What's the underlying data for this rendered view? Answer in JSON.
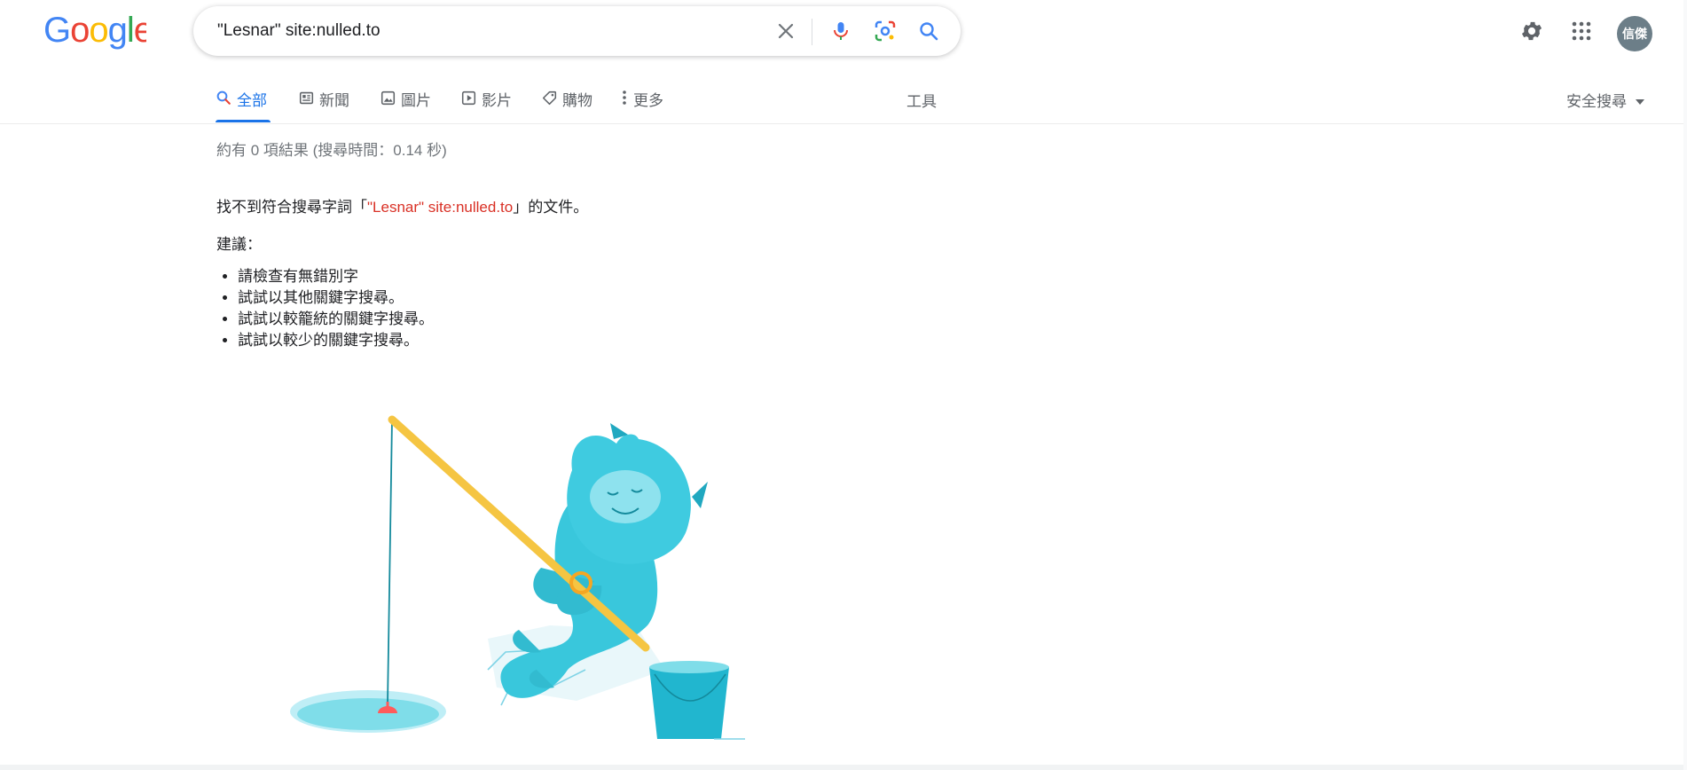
{
  "header": {
    "logo_text": "Google",
    "search": {
      "query": "\"Lesnar\" site:nulled.to"
    },
    "icons": {
      "clear": "close-icon",
      "voice": "microphone-icon",
      "lens": "camera-lens-icon",
      "search": "search-icon",
      "settings": "gear-icon",
      "apps": "apps-grid-icon"
    },
    "avatar_text": "信傑"
  },
  "tabs": [
    {
      "label": "全部",
      "icon": "search-icon",
      "active": true
    },
    {
      "label": "新聞",
      "icon": "news-icon"
    },
    {
      "label": "圖片",
      "icon": "image-icon"
    },
    {
      "label": "影片",
      "icon": "video-icon"
    },
    {
      "label": "購物",
      "icon": "tag-icon"
    },
    {
      "label": "更多",
      "icon": "more-vert-icon"
    }
  ],
  "tools_label": "工具",
  "safe_search_label": "安全搜尋",
  "results": {
    "stats": "約有 0 項結果 (搜尋時間：0.14 秒)",
    "no_match_prefix": "找不到符合搜尋字詞「",
    "no_match_query": "\"Lesnar\" site:nulled.to",
    "no_match_suffix": "」的文件。",
    "suggestions_title": "建議：",
    "suggestions": [
      "請檢查有無錯別字",
      "試試以其他關鍵字搜尋。",
      "試試以較籠統的關鍵字搜尋。",
      "試試以較少的關鍵字搜尋。"
    ]
  },
  "colors": {
    "blue": "#4285F4",
    "red": "#EA4335",
    "yellow": "#FBBC05",
    "green": "#34A853",
    "accent": "#1a73e8"
  }
}
